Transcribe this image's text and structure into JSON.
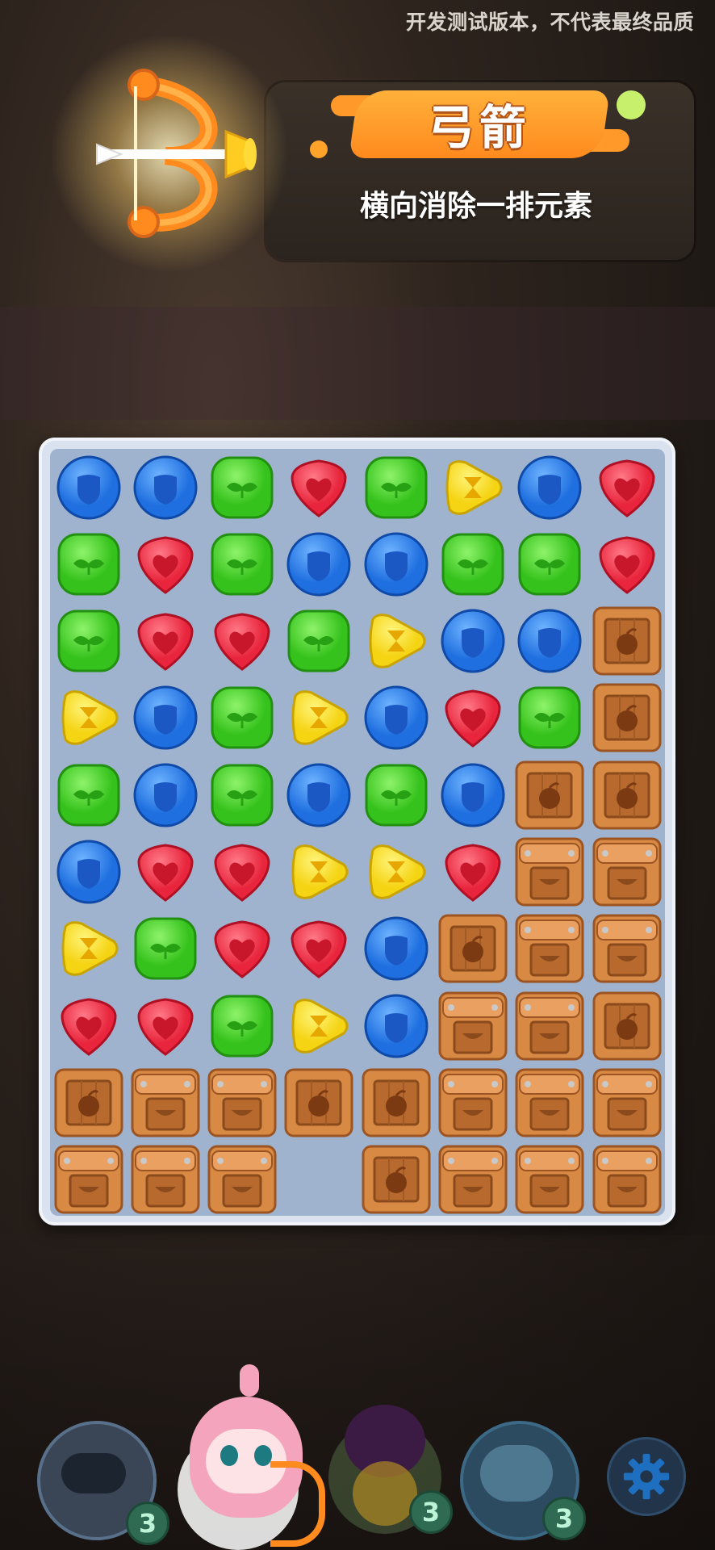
{
  "watermark": "开发测试版本，不代表最终品质",
  "powerup": {
    "title": "弓箭",
    "description": "横向消除一排元素"
  },
  "board": {
    "columns": 8,
    "rows": 10,
    "grid": [
      [
        "blue",
        "blue",
        "green",
        "red",
        "green",
        "yellow",
        "blue",
        "red"
      ],
      [
        "green",
        "red",
        "green",
        "blue",
        "blue",
        "green",
        "green",
        "red"
      ],
      [
        "green",
        "red",
        "red",
        "green",
        "yellow",
        "blue",
        "blue",
        "crate"
      ],
      [
        "yellow",
        "blue",
        "green",
        "yellow",
        "blue",
        "red",
        "green",
        "crate"
      ],
      [
        "green",
        "blue",
        "green",
        "blue",
        "green",
        "blue",
        "crate",
        "crate"
      ],
      [
        "blue",
        "red",
        "red",
        "yellow",
        "yellow",
        "red",
        "chest",
        "chest"
      ],
      [
        "yellow",
        "green",
        "red",
        "red",
        "blue",
        "crate",
        "chest",
        "chest"
      ],
      [
        "red",
        "red",
        "green",
        "yellow",
        "blue",
        "chest",
        "chest",
        "crate"
      ],
      [
        "crate",
        "chest",
        "chest",
        "crate",
        "crate",
        "chest",
        "chest",
        "chest"
      ],
      [
        "chest",
        "chest",
        "chest",
        "empty",
        "crate",
        "chest",
        "chest",
        "chest"
      ]
    ],
    "piece_colors": {
      "blue": "#1f6fe0",
      "green": "#35c21c",
      "red": "#e8253c",
      "yellow": "#f5d414",
      "wood": "#d88a45"
    }
  },
  "characters": [
    {
      "name": "slot-1",
      "count": "3"
    },
    {
      "name": "slot-2-selected"
    },
    {
      "name": "slot-3",
      "count": "3"
    },
    {
      "name": "slot-4",
      "count": "3"
    }
  ],
  "icons": {
    "bow": "bow-arrow-icon",
    "settings": "gear-icon"
  }
}
